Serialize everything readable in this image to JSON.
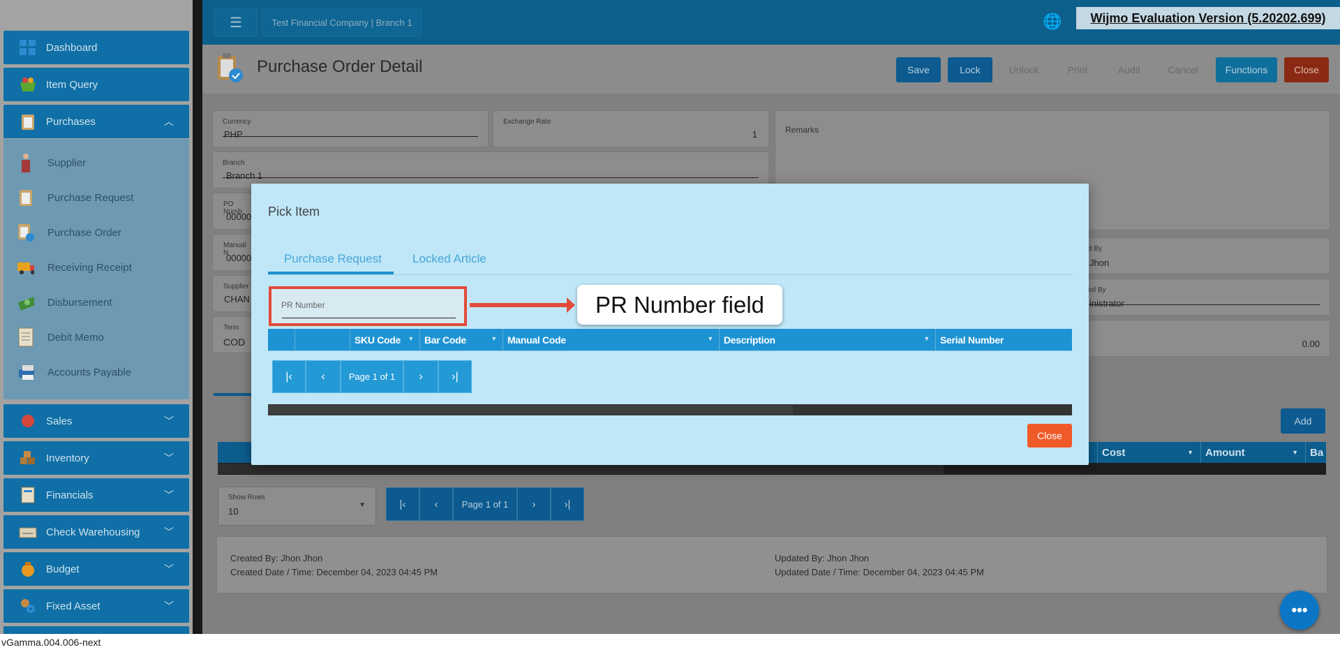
{
  "sidebar": {
    "items": [
      {
        "label": "Dashboard",
        "icon": "dashboard-icon"
      },
      {
        "label": "Item Query",
        "icon": "basket-icon"
      },
      {
        "label": "Purchases",
        "icon": "clipboard-icon"
      },
      {
        "label": "Sales",
        "icon": "sales-icon"
      },
      {
        "label": "Inventory",
        "icon": "boxes-icon"
      },
      {
        "label": "Financials",
        "icon": "ledger-icon"
      },
      {
        "label": "Check Warehousing",
        "icon": "check-icon"
      },
      {
        "label": "Budget",
        "icon": "moneybag-icon"
      },
      {
        "label": "Fixed Asset",
        "icon": "gear-icon"
      }
    ],
    "purchases_sub": [
      {
        "label": "Supplier",
        "icon": "person-icon"
      },
      {
        "label": "Purchase Request",
        "icon": "clipboard-icon"
      },
      {
        "label": "Purchase Order",
        "icon": "order-icon"
      },
      {
        "label": "Receiving Receipt",
        "icon": "truck-icon"
      },
      {
        "label": "Disbursement",
        "icon": "money-icon"
      },
      {
        "label": "Debit Memo",
        "icon": "memo-icon"
      },
      {
        "label": "Accounts Payable",
        "icon": "printer-icon"
      }
    ]
  },
  "topbar": {
    "company": "Test Financial Company | Branch 1",
    "watermark": "Wijmo Evaluation Version (5.20202.699)"
  },
  "header": {
    "title": "Purchase Order Detail",
    "buttons": {
      "save": "Save",
      "lock": "Lock",
      "unlock": "Unlock",
      "print": "Print",
      "audit": "Audit",
      "cancel": "Cancel",
      "functions": "Functions",
      "close": "Close"
    }
  },
  "form": {
    "currency_label": "Currency",
    "currency_value": "PHP",
    "exchange_label": "Exchange Rate",
    "exchange_value": "1",
    "branch_label": "Branch",
    "branch_value": "Branch 1",
    "po_label": "PO Numb",
    "po_value": "00000",
    "manual_label": "Manual N",
    "manual_value": "00000",
    "supplier_label": "Supplier",
    "supplier_value": "CHAN",
    "term_label": "Term",
    "term_value": "COD",
    "remarks_label": "Remarks",
    "by1_label": "d By",
    "by1_value": "Jhon",
    "by2_label": "ed By",
    "by2_value": "inistrator",
    "amount_value": "0.00"
  },
  "dialog": {
    "title": "Pick Item",
    "tabs": [
      "Purchase Request",
      "Locked Article"
    ],
    "pr_placeholder": "PR Number",
    "callout": "PR Number field",
    "columns": [
      "SKU Code",
      "Bar Code",
      "Manual Code",
      "Description",
      "Serial Number"
    ],
    "page_text": "Page 1 of 1",
    "close": "Close"
  },
  "lower": {
    "add": "Add",
    "columns": [
      "Cost",
      "Amount",
      "Ba"
    ],
    "show_rows_label": "Show Rows",
    "show_rows_value": "10",
    "page_text": "Page 1 of 1"
  },
  "audit": {
    "created_by": "Created By: Jhon Jhon",
    "created_date": "Created Date / Time: December 04, 2023 04:45 PM",
    "updated_by": "Updated By: Jhon Jhon",
    "updated_date": "Updated Date / Time: December 04, 2023 04:45 PM"
  },
  "status": "vGamma.004.006-next",
  "colors": {
    "accent": "#1e93d3",
    "close_red": "#f05a28",
    "highlight": "#e34a3a"
  }
}
